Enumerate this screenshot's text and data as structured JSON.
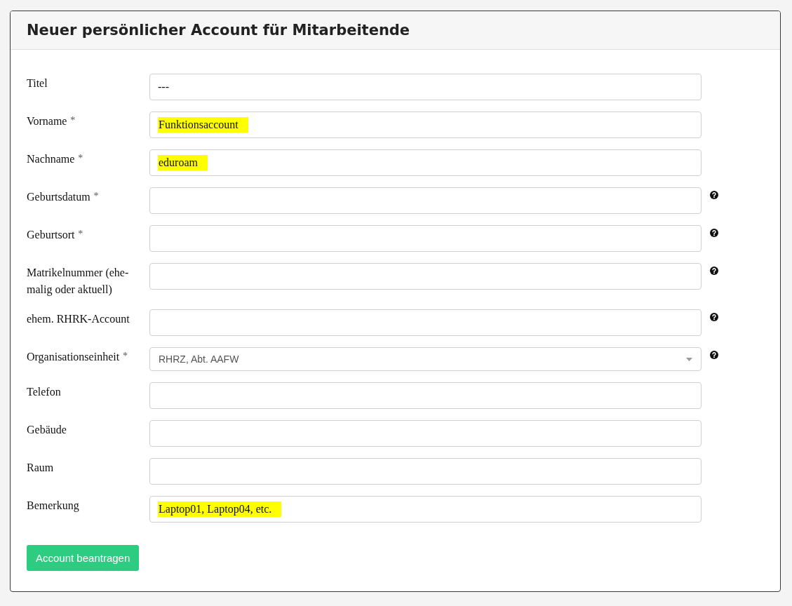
{
  "card": {
    "title": "Neuer persönlicher Account für Mitarbeitende"
  },
  "fields": [
    {
      "label": "Titel",
      "required": false,
      "kind": "text",
      "value": "---",
      "highlighted": false,
      "help": false
    },
    {
      "label": "Vorname",
      "required": true,
      "kind": "text",
      "value": "Funktionsaccount",
      "highlighted": true,
      "help": false
    },
    {
      "label": "Nachname",
      "required": true,
      "kind": "text",
      "value": "eduroam",
      "highlighted": true,
      "help": false
    },
    {
      "label": "Geburtsdatum",
      "required": true,
      "kind": "text",
      "help": true,
      "highlighted": false
    },
    {
      "label": "Geburtsort",
      "required": true,
      "kind": "text",
      "help": true,
      "highlighted": false
    },
    {
      "label": "Matrikelnummer (ehe-malig oder aktuell)",
      "required": false,
      "kind": "text",
      "help": true,
      "highlighted": false
    },
    {
      "label": "ehem. RHRK-Account",
      "required": false,
      "kind": "text",
      "help": true,
      "highlighted": false
    },
    {
      "label": "Organisationseinheit",
      "required": true,
      "kind": "select",
      "value": "RHRZ, Abt. AAFW",
      "help": true,
      "highlighted": false
    },
    {
      "label": "Telefon",
      "required": false,
      "kind": "text",
      "help": false,
      "highlighted": false
    },
    {
      "label": "Gebäude",
      "required": false,
      "kind": "text",
      "help": false,
      "highlighted": false
    },
    {
      "label": "Raum",
      "required": false,
      "kind": "text",
      "help": false,
      "highlighted": false
    },
    {
      "label": "Bemerkung",
      "required": false,
      "kind": "text",
      "value": "Laptop01, Laptop04, etc.",
      "highlighted": true,
      "help": false
    }
  ],
  "required_mark": "*",
  "submit_button": "Account beantragen"
}
